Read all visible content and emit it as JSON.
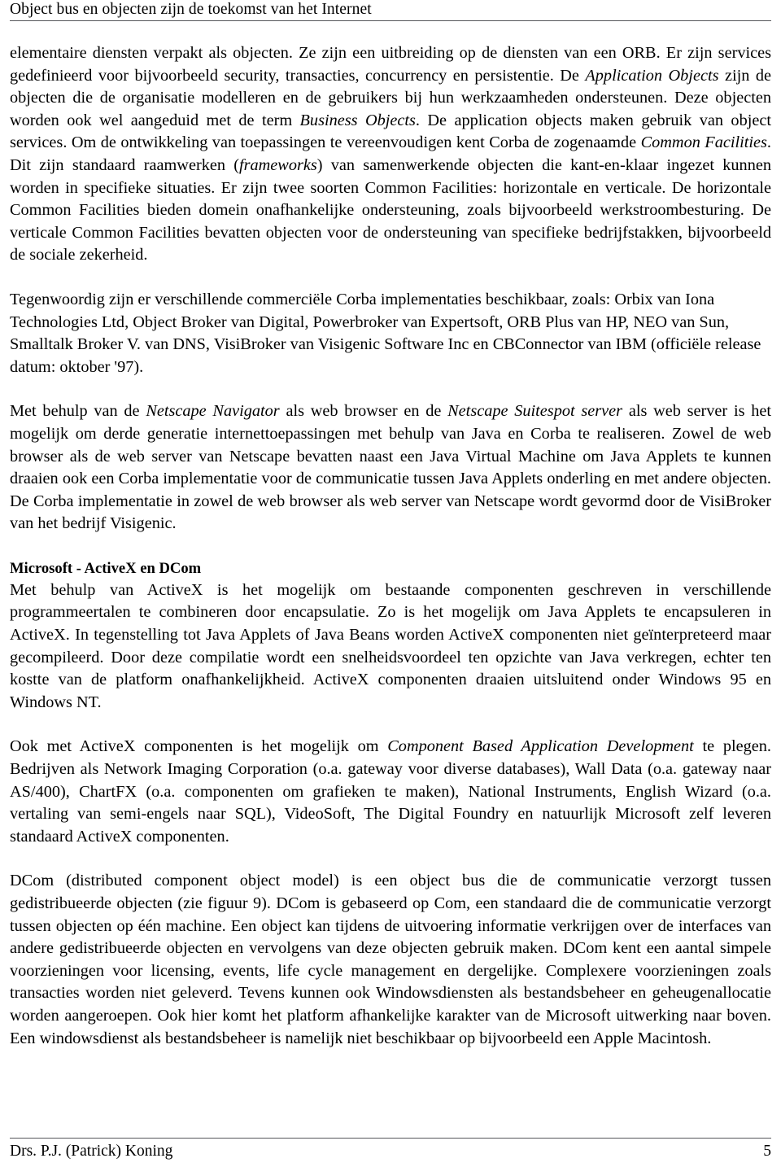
{
  "header": {
    "title": "Object bus en objecten zijn de toekomst van het Internet"
  },
  "footer": {
    "author": "Drs. P.J. (Patrick) Koning",
    "page_number": "5"
  },
  "content": {
    "paragraph_corba_services": {
      "run1": "elementaire diensten verpakt als objecten. Ze zijn een uitbreiding op de diensten van een ORB. Er zijn services gedefinieerd voor bijvoorbeeld security, transacties, concurrency en persistentie. De ",
      "em1": "Application Objects",
      "run2": " zijn de objecten die de organisatie modelleren en de gebruikers bij hun werkzaamheden ondersteunen. Deze objecten worden ook wel aangeduid met de term ",
      "em2": "Business Objects",
      "run3": ". De application objects maken gebruik van object services. Om de ontwikkeling van toepassingen te vereenvoudigen kent Corba de zogenaamde ",
      "em3": "Common Facilities",
      "run4": ". Dit zijn standaard raamwerken (",
      "em4": "frameworks",
      "run5": ") van samenwerkende objecten die kant-en-klaar ingezet kunnen worden in specifieke situaties. Er zijn twee soorten Common Facilities: horizontale en verticale. De horizontale Common Facilities bieden domein onafhankelijke ondersteuning, zoals bijvoorbeeld werkstroombesturing. De verticale Common Facilities bevatten objecten voor de ondersteuning van specifieke bedrijfstakken, bijvoorbeeld de sociale zekerheid."
    },
    "paragraph_implementations": {
      "text": "Tegenwoordig zijn er verschillende commerciële Corba implementaties beschikbaar, zoals: Orbix van Iona Technologies Ltd, Object Broker van Digital, Powerbroker van Expertsoft, ORB Plus van HP, NEO van Sun, Smalltalk Broker V. van DNS, VisiBroker van Visigenic Software Inc en CBConnector van IBM (officiële release datum: oktober '97)."
    },
    "paragraph_netscape": {
      "run1": "Met behulp van de ",
      "em1": "Netscape Navigator",
      "run2": " als web browser en de ",
      "em2": "Netscape Suitespot server",
      "run3": " als web server is het mogelijk om derde generatie internettoepassingen met behulp van Java en Corba te realiseren.  Zowel de web browser als de web server van Netscape bevatten naast een Java Virtual Machine om Java Applets te kunnen draaien ook een Corba implementatie voor de communicatie tussen Java Applets onderling en met andere objecten.  De Corba implementatie in zowel de web browser als web server van Netscape wordt gevormd door de VisiBroker van het bedrijf Visigenic."
    },
    "heading_microsoft": "Microsoft - ActiveX en DCom",
    "paragraph_activex": {
      "text": "Met behulp van ActiveX is het mogelijk om bestaande componenten geschreven in verschillende programmeertalen te combineren door encapsulatie. Zo is het mogelijk om Java Applets te encapsuleren in ActiveX. In tegenstelling tot Java Applets of Java Beans worden ActiveX componenten niet geïnterpreteerd maar gecompileerd. Door deze compilatie wordt een snelheidsvoordeel ten opzichte van Java verkregen, echter ten kostte van de platform onafhan­kelijkheid. ActiveX componenten draaien uitsluitend onder Windows 95 en Windows NT."
    },
    "paragraph_cbad": {
      "run1": "Ook met ActiveX componenten is het mogelijk om ",
      "em1": "Component Based Application Development",
      "run2": " te plegen. Bedrijven als Network Imaging Corporation (o.a. gateway voor diverse databases), Wall Data (o.a. gateway naar AS/400), ChartFX (o.a. componenten om grafieken te maken), National Instruments, English Wizard (o.a. vertaling van semi-engels naar SQL), VideoSoft, The Digital Foundry en natuurlijk Microsoft zelf leveren standaard ActiveX componenten."
    },
    "paragraph_dcom": {
      "text": "DCom (distributed component object model)  is een object bus die de communicatie verzorgt tussen gedistribueerde objecten (zie figuur 9). DCom is gebaseerd op Com, een standaard die de communicatie verzorgt tussen objecten op één machine. Een object kan tijdens de uitvoering informatie verkrijgen over de interfaces van andere gedistribueerde objecten en vervolgens van deze objecten gebruik maken. DCom kent een aantal simpele voorzieningen voor licensing, events, life cycle management en dergelijke. Complexere  voorzieningen zoals transacties worden niet geleverd. Tevens kunnen ook Windowsdiensten als bestandsbeheer en geheugenallocatie worden aangeroepen. Ook hier komt het platform afhankelijke karakter van de Microsoft uitwerking naar boven. Een windowsdienst als bestandsbeheer is namelijk niet beschikbaar op bijvoorbeeld een Apple Macintosh."
    }
  }
}
